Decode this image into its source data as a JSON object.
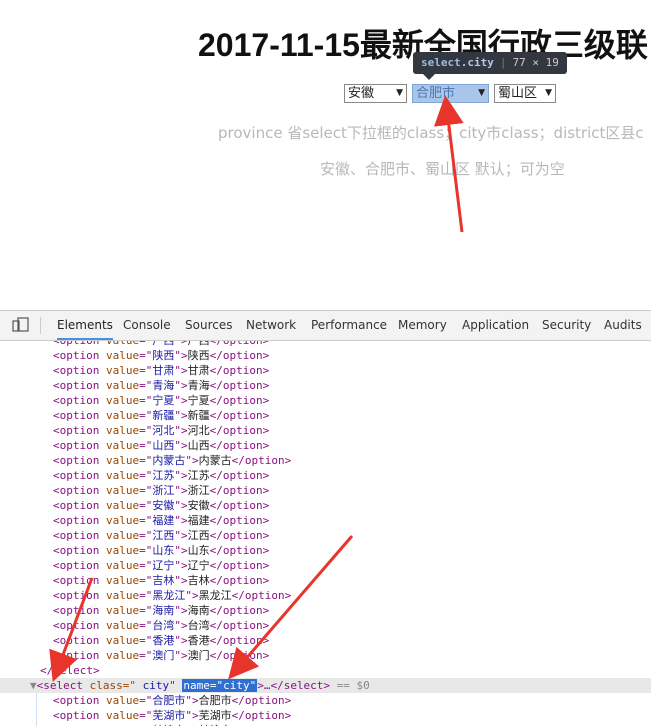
{
  "page": {
    "title": "2017-11-15最新全国行政三级联",
    "province_select": "安徽",
    "city_select": "合肥市",
    "district_select": "蜀山区",
    "tooltip": {
      "tag": "select",
      "cls": ".city",
      "size": "77 × 19"
    },
    "desc_1": "province 省select下拉框的class；city市class；district区县c",
    "desc_2": "安徽、合肥市、蜀山区 默认；可为空"
  },
  "devtools": {
    "tabs": [
      "Elements",
      "Console",
      "Sources",
      "Network",
      "Performance",
      "Memory",
      "Application",
      "Security",
      "Audits"
    ],
    "active_tab": "Elements",
    "option_lines": [
      {
        "v": "广西",
        "t": "广西"
      },
      {
        "v": "陕西",
        "t": "陕西"
      },
      {
        "v": "甘肃",
        "t": "甘肃"
      },
      {
        "v": "青海",
        "t": "青海"
      },
      {
        "v": "宁夏",
        "t": "宁夏"
      },
      {
        "v": "新疆",
        "t": "新疆"
      },
      {
        "v": "河北",
        "t": "河北"
      },
      {
        "v": "山西",
        "t": "山西"
      },
      {
        "v": "内蒙古",
        "t": "内蒙古"
      },
      {
        "v": "江苏",
        "t": "江苏"
      },
      {
        "v": "浙江",
        "t": "浙江"
      },
      {
        "v": "安徽",
        "t": "安徽"
      },
      {
        "v": "福建",
        "t": "福建"
      },
      {
        "v": "江西",
        "t": "江西"
      },
      {
        "v": "山东",
        "t": "山东"
      },
      {
        "v": "辽宁",
        "t": "辽宁"
      },
      {
        "v": "吉林",
        "t": "吉林"
      },
      {
        "v": "黑龙江",
        "t": "黑龙江"
      },
      {
        "v": "海南",
        "t": "海南"
      },
      {
        "v": "台湾",
        "t": "台湾"
      },
      {
        "v": "香港",
        "t": "香港"
      },
      {
        "v": "澳门",
        "t": "澳门"
      }
    ],
    "close_select": "</select>",
    "selected_line": {
      "tag_open": "<select",
      "class_attr": " class=\"",
      "class_val": " city",
      "name_highlight": "name=\"city\"",
      "tail": ">…</select>",
      "marker": "== $0"
    },
    "child_options": [
      {
        "v": "合肥市",
        "t": "合肥市"
      },
      {
        "v": "芜湖市",
        "t": "芜湖市"
      },
      {
        "v": "蚌埠市",
        "t": "蚌埠市"
      }
    ]
  }
}
